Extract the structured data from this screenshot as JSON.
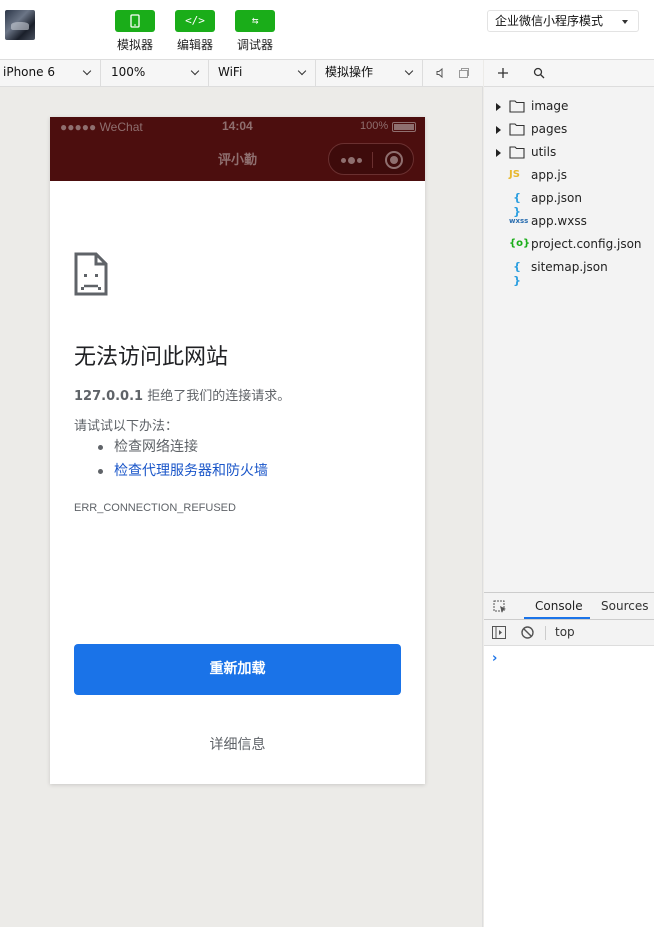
{
  "toolbar": {
    "buttons": [
      {
        "icon": "▯",
        "label": "模拟器"
      },
      {
        "icon": "</>",
        "label": "编辑器"
      },
      {
        "icon": "⇆",
        "label": "调试器"
      }
    ],
    "mode": "企业微信小程序模式"
  },
  "device_bar": {
    "device": "iPhone 6",
    "zoom": "100%",
    "network": "WiFi",
    "operation": "模拟操作"
  },
  "phone": {
    "status": {
      "signal": "●●●●● WeChat",
      "time": "14:04",
      "battery": "100%"
    },
    "nav_title": "评小勤",
    "error": {
      "title": "无法访问此网站",
      "host": "127.0.0.1",
      "desc": "拒绝了我们的连接请求。",
      "try_text": "请试试以下办法：",
      "suggestions": [
        "检查网络连接",
        "检查代理服务器和防火墙"
      ],
      "code": "ERR_CONNECTION_REFUSED",
      "reload": "重新加载",
      "details": "详细信息"
    }
  },
  "file_tree": [
    {
      "name": "image",
      "type": "folder"
    },
    {
      "name": "pages",
      "type": "folder"
    },
    {
      "name": "utils",
      "type": "folder"
    },
    {
      "name": "app.js",
      "type": "js",
      "icon": "JS"
    },
    {
      "name": "app.json",
      "type": "json",
      "icon": "{ }"
    },
    {
      "name": "app.wxss",
      "type": "wxss",
      "icon": "wxss"
    },
    {
      "name": "project.config.json",
      "type": "config",
      "icon": "{o}"
    },
    {
      "name": "sitemap.json",
      "type": "json",
      "icon": "{ }"
    }
  ],
  "console": {
    "tabs": [
      "Console",
      "Sources"
    ],
    "context": "top",
    "prompt": "›"
  },
  "colors": {
    "accent": "#1aad19",
    "navbar": "#4c0e0e",
    "reload": "#1a73e8",
    "link": "#1a56c9"
  }
}
